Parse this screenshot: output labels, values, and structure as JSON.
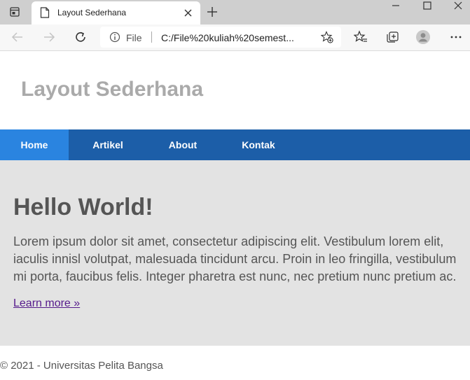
{
  "browser": {
    "tab_title": "Layout Sederhana",
    "address_scheme": "File",
    "address_url": "C:/File%20kuliah%20semest..."
  },
  "site": {
    "title": "Layout Sederhana",
    "nav": [
      {
        "label": "Home",
        "active": true
      },
      {
        "label": "Artikel",
        "active": false
      },
      {
        "label": "About",
        "active": false
      },
      {
        "label": "Kontak",
        "active": false
      }
    ],
    "hero": {
      "title": "Hello World!",
      "text": "Lorem ipsum dolor sit amet, consectetur adipiscing elit. Vestibulum lorem elit, iaculis innisl volutpat, malesuada tincidunt arcu. Proin in leo fringilla, vestibulum mi porta, faucibus felis. Integer pharetra est nunc, nec pretium nunc pretium ac.",
      "link": "Learn more »"
    },
    "footer": "© 2021 - Universitas Pelita Bangsa"
  },
  "colors": {
    "nav_bg": "#1c5ea8",
    "nav_active": "#2a84e0",
    "hero_bg": "#e3e3e3",
    "title_gray": "#aaaaaa",
    "link_visited": "#551a8b"
  },
  "icons": [
    "window-menu-icon",
    "page-icon",
    "close-icon",
    "plus-icon",
    "minimize-icon",
    "maximize-icon",
    "back-arrow-icon",
    "forward-arrow-icon",
    "refresh-icon",
    "info-icon",
    "add-favorite-icon",
    "favorites-icon",
    "collections-icon",
    "profile-icon",
    "more-icon"
  ]
}
